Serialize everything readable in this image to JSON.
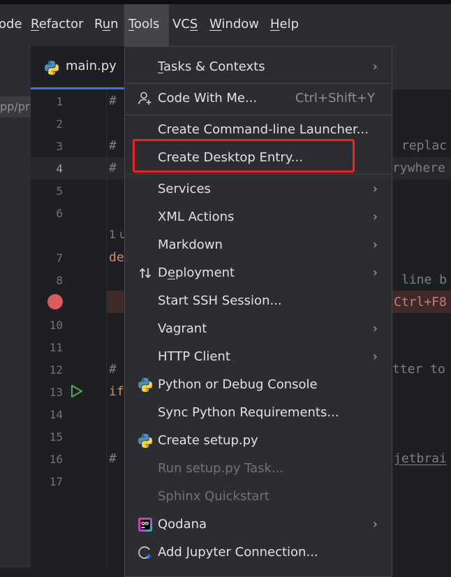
{
  "menubar": {
    "items": [
      {
        "label": "ode"
      },
      {
        "label": "Refactor"
      },
      {
        "label": "Run"
      },
      {
        "label": "Tools"
      },
      {
        "label": "VCS"
      },
      {
        "label": "Window"
      },
      {
        "label": "Help"
      }
    ]
  },
  "sidebar": {
    "path_label": "pp/pr"
  },
  "tab": {
    "label": "main.py",
    "icon": "python-icon"
  },
  "editor": {
    "line_numbers": [
      "1",
      "2",
      "3",
      "4",
      "5",
      "6",
      "7",
      "8",
      "10",
      "11",
      "12",
      "13",
      "14",
      "15",
      "16",
      "17"
    ],
    "code": {
      "line1": "#",
      "line3": "#",
      "line4": "#",
      "usages": "1 u",
      "def_kw": "de",
      "line12": "#",
      "if_kw": "if",
      "line16": "#"
    },
    "right_fragments": {
      "replace": "replac",
      "everywhere": "rywhere",
      "line_b": "line b",
      "ctrl_f8": "Ctrl+F8",
      "tter_to": "tter to",
      "jetbrai": "jetbrai"
    }
  },
  "tools_menu": {
    "items": [
      {
        "label": "Tasks & Contexts",
        "submenu": true
      },
      {
        "label": "Code With Me...",
        "shortcut": "Ctrl+Shift+Y",
        "icon": "person-add-icon"
      },
      {
        "label": "Create Command-line Launcher..."
      },
      {
        "label": "Create Desktop Entry..."
      },
      {
        "label": "Services",
        "submenu": true
      },
      {
        "label": "XML Actions",
        "submenu": true
      },
      {
        "label": "Markdown",
        "submenu": true
      },
      {
        "label": "Deployment",
        "submenu": true,
        "icon": "up-down-arrows-icon"
      },
      {
        "label": "Start SSH Session..."
      },
      {
        "label": "Vagrant",
        "submenu": true
      },
      {
        "label": "HTTP Client",
        "submenu": true
      },
      {
        "label": "Python or Debug Console",
        "icon": "python-icon"
      },
      {
        "label": "Sync Python Requirements..."
      },
      {
        "label": "Create setup.py",
        "icon": "python-icon"
      },
      {
        "label": "Run setup.py Task...",
        "disabled": true
      },
      {
        "label": "Sphinx Quickstart",
        "disabled": true
      },
      {
        "label": "Qodana",
        "submenu": true,
        "icon": "qodana-icon"
      },
      {
        "label": "Add Jupyter Connection...",
        "icon": "jupyter-connection-icon"
      }
    ],
    "submenu_arrow": "›"
  },
  "colors": {
    "accent": "#3574f0",
    "highlight_box": "#ee2222",
    "breakpoint": "#db5c5c"
  }
}
